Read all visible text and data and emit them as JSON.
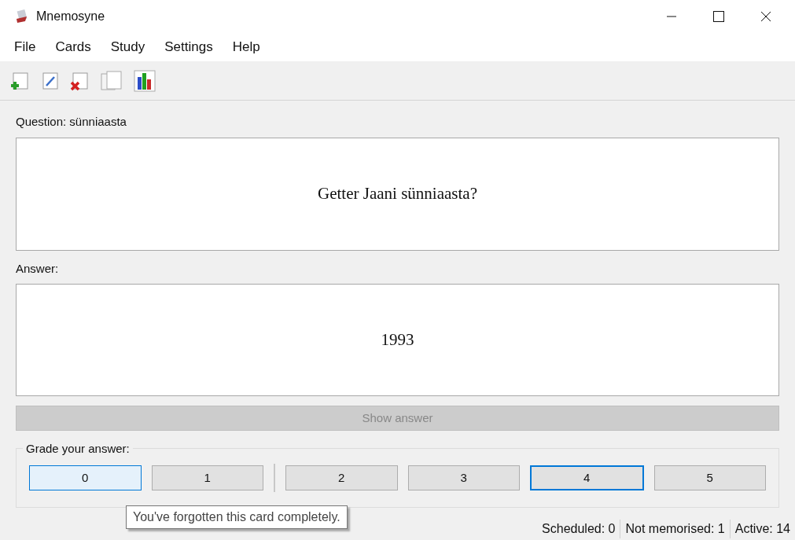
{
  "window": {
    "title": "Mnemosyne"
  },
  "menu": [
    "File",
    "Cards",
    "Study",
    "Settings",
    "Help"
  ],
  "question": {
    "label": "Question: sünniaasta",
    "text": "Getter Jaani sünniaasta?"
  },
  "answer": {
    "label": "Answer:",
    "text": "1993"
  },
  "show_answer": {
    "label": "Show answer",
    "disabled": true
  },
  "grading": {
    "title": "Grade your answer:",
    "items": [
      {
        "kind": "button",
        "label": "0",
        "hovered": true,
        "focused": false
      },
      {
        "kind": "button",
        "label": "1",
        "hovered": false,
        "focused": false
      },
      {
        "kind": "separator"
      },
      {
        "kind": "button",
        "label": "2",
        "hovered": false,
        "focused": false
      },
      {
        "kind": "button",
        "label": "3",
        "hovered": false,
        "focused": false
      },
      {
        "kind": "button",
        "label": "4",
        "hovered": false,
        "focused": true
      },
      {
        "kind": "button",
        "label": "5",
        "hovered": false,
        "focused": false
      }
    ]
  },
  "tooltip": "You've forgotten this card completely.",
  "status_bar": [
    "Scheduled: 0",
    "Not memorised: 1",
    "Active: 14"
  ]
}
